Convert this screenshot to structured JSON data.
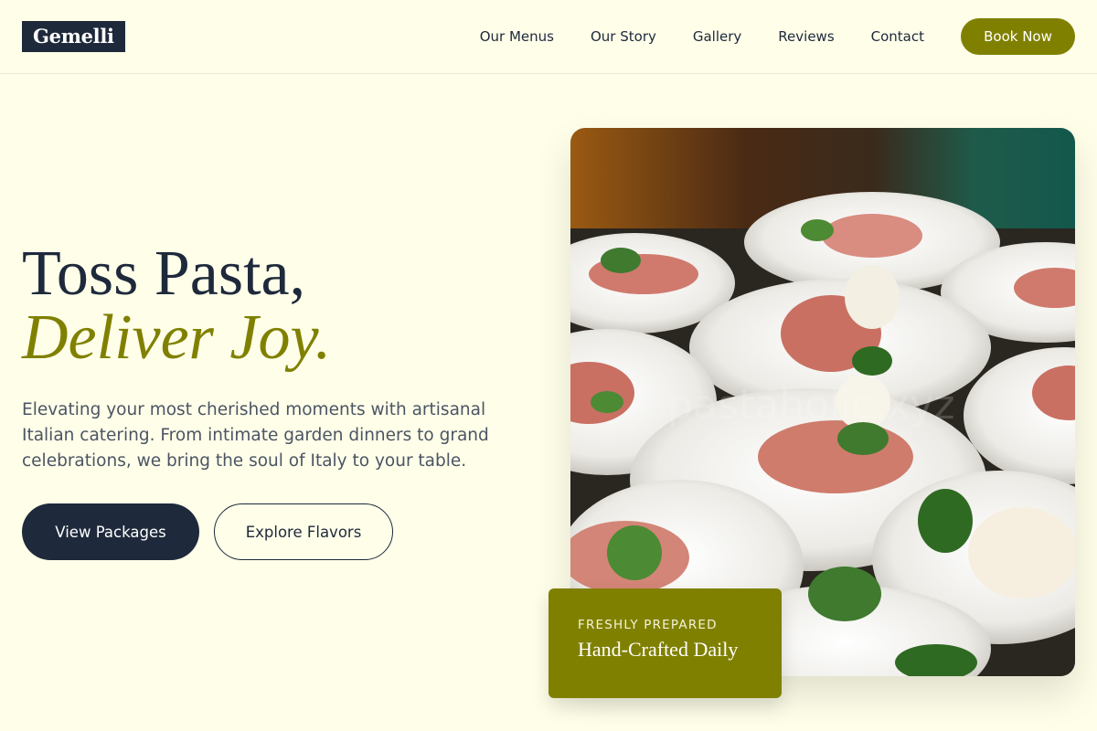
{
  "header": {
    "logo": "Gemelli",
    "nav": [
      "Our Menus",
      "Our Story",
      "Gallery",
      "Reviews",
      "Contact"
    ],
    "cta": "Book Now"
  },
  "hero": {
    "title_line1": "Toss Pasta,",
    "title_line2": "Deliver Joy.",
    "description": "Elevating your most cherished moments with artisanal Italian catering. From intimate garden dinners to grand celebrations, we bring the soul of Italy to your table.",
    "primary_cta": "View Packages",
    "secondary_cta": "Explore Flavors"
  },
  "image": {
    "watermark": "pastaholic.xyz"
  },
  "badge": {
    "kicker": "FRESHLY PREPARED",
    "title": "Hand-Crafted Daily"
  },
  "colors": {
    "background": "#fefee9",
    "navy": "#1e293b",
    "olive": "#808000"
  }
}
